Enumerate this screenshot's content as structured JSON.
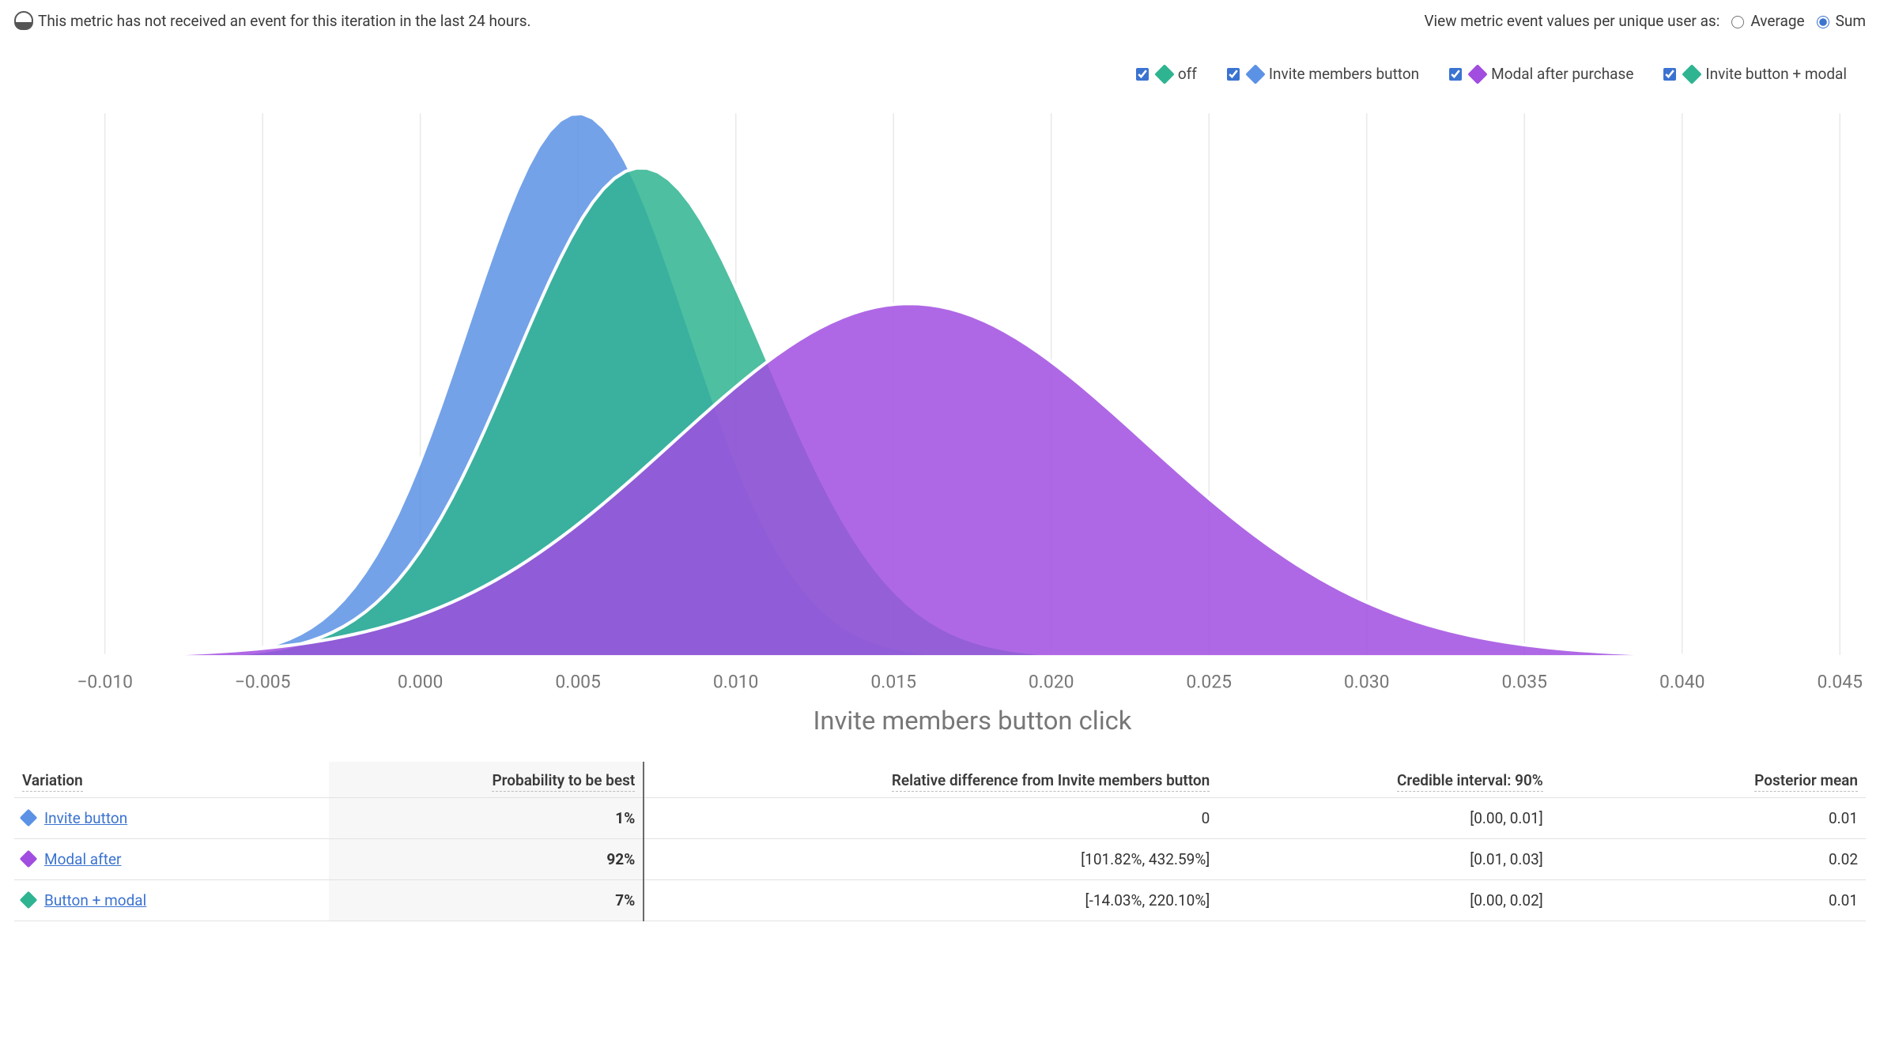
{
  "alert": {
    "text": "This metric has not received an event for this iteration in the last 24 hours."
  },
  "viewmode": {
    "label": "View metric event values per unique user as:",
    "average": "Average",
    "sum": "Sum",
    "selected": "sum"
  },
  "legend": {
    "items": [
      {
        "label": "off",
        "color": "#2fb491"
      },
      {
        "label": "Invite members button",
        "color": "#5b92e5"
      },
      {
        "label": "Modal after purchase",
        "color": "#a14de0"
      },
      {
        "label": "Invite button + modal",
        "color": "#2fb491"
      }
    ]
  },
  "chart_data": {
    "type": "area",
    "title": "",
    "xlabel": "Invite members button click",
    "ylabel": "",
    "ylim": [
      0,
      1
    ],
    "xlim": [
      -0.01,
      0.045
    ],
    "x_ticks": [
      "−0.010",
      "−0.005",
      "0.000",
      "0.005",
      "0.010",
      "0.015",
      "0.020",
      "0.025",
      "0.030",
      "0.035",
      "0.040",
      "0.045"
    ],
    "series": [
      {
        "name": "Invite members button",
        "color": "#5b92e5",
        "mean": 0.005,
        "sd": 0.0035,
        "peak_rel": 1.0
      },
      {
        "name": "Invite button + modal",
        "color": "#2fb491",
        "mean": 0.007,
        "sd": 0.004,
        "peak_rel": 0.9
      },
      {
        "name": "Modal after purchase",
        "color": "#a14de0",
        "mean": 0.0155,
        "sd": 0.0075,
        "peak_rel": 0.65
      }
    ]
  },
  "table": {
    "headers": {
      "variation": "Variation",
      "prob": "Probability to be best",
      "reldiff": "Relative difference from Invite members button",
      "ci": "Credible interval: 90%",
      "postmean": "Posterior mean"
    },
    "rows": [
      {
        "color": "#5b92e5",
        "name": "Invite button",
        "prob": "1%",
        "reldiff": "0",
        "ci": "[0.00, 0.01]",
        "postmean": "0.01"
      },
      {
        "color": "#a14de0",
        "name": "Modal after",
        "prob": "92%",
        "reldiff": "[101.82%, 432.59%]",
        "ci": "[0.01, 0.03]",
        "postmean": "0.02"
      },
      {
        "color": "#2fb491",
        "name": "Button + modal",
        "prob": "7%",
        "reldiff": "[-14.03%, 220.10%]",
        "ci": "[0.00, 0.02]",
        "postmean": "0.01"
      }
    ]
  }
}
